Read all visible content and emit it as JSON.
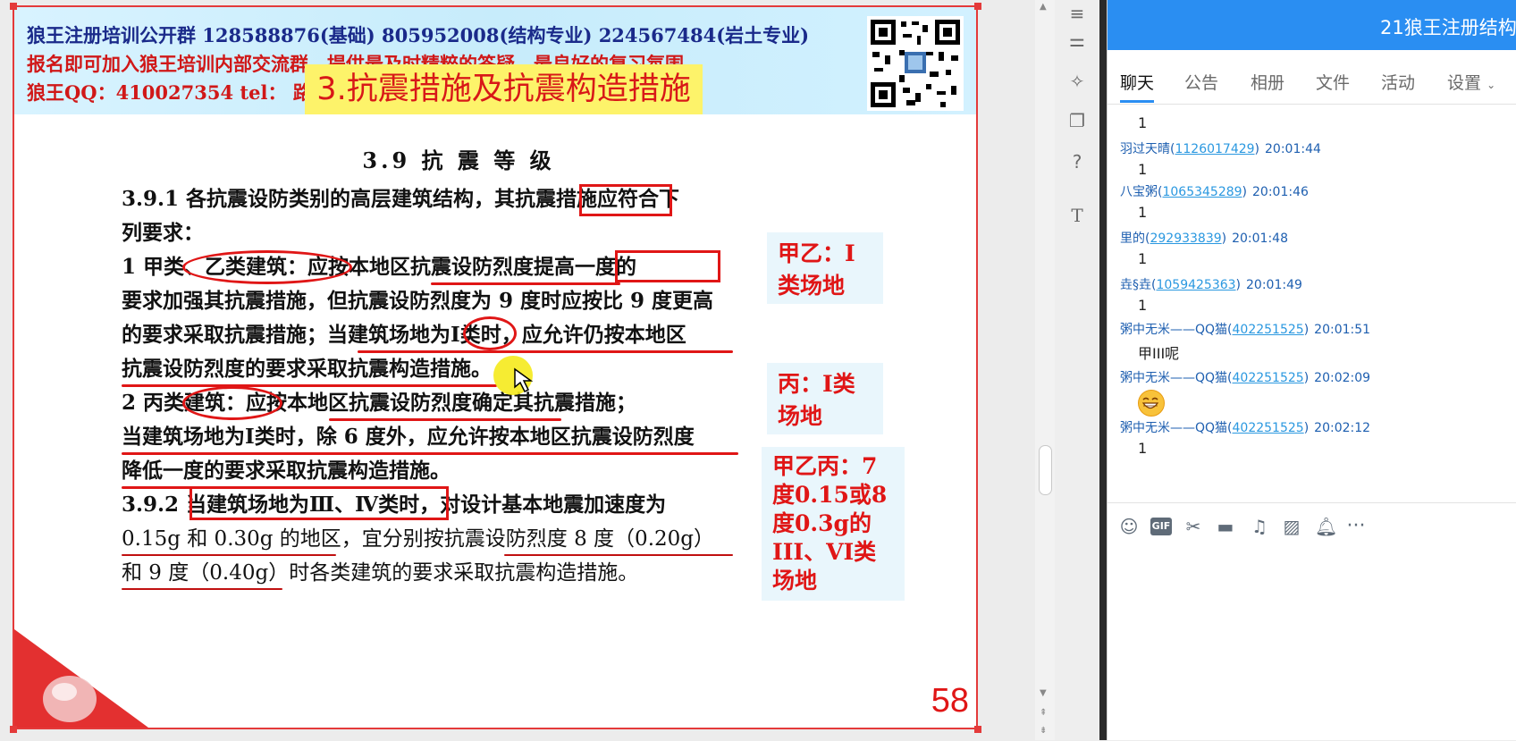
{
  "slide": {
    "banner": {
      "line1": "狼王注册培训公开群 128588876(基础)   805952008(结构专业) 224567484(岩土专业)",
      "line2": "报名即可加入狼王培训内部交流群，提供最及时精粹的答疑，最良好的复习氛围。",
      "line3": "狼王QQ：410027354     tel：                                  路专业)",
      "section_title": "3.抗震措施及抗震构造措施"
    },
    "doc": {
      "heading": "3.9  抗 震 等 级",
      "l1": "3.9.1  各抗震设防类别的高层建筑结构，其抗震措施应符合下",
      "l2": "列要求：",
      "l3": "    1  甲类、乙类建筑：应按本地区抗震设防烈度提高一度的",
      "l4": "要求加强其抗震措施，但抗震设防烈度为 9 度时应按比 9 度更高",
      "l5": "的要求采取抗震措施；当建筑场地为Ⅰ类时，应允许仍按本地区",
      "l6": "抗震设防烈度的要求采取抗震构造措施。",
      "l7": "    2  丙类建筑：应按本地区抗震设防烈度确定其抗震措施；",
      "l8": "当建筑场地为Ⅰ类时，除 6 度外，应允许按本地区抗震设防烈度",
      "l9": "降低一度的要求采取抗震构造措施。",
      "l10": "3.9.2  当建筑场地为Ⅲ、Ⅳ类时，对设计基本地震加速度为",
      "l11": "0.15g 和 0.30g 的地区，宜分别按抗震设防烈度 8 度（0.20g）",
      "l12": "和 9 度（0.40g）时各类建筑的要求采取抗震构造措施。"
    },
    "notes": {
      "n1a": "甲乙：I",
      "n1b": "类场地",
      "n2a": "丙：I类",
      "n2b": "场地",
      "n3a": "甲乙丙：7",
      "n3b": "度0.15或8",
      "n3c": "度0.3g的",
      "n3d": "III、VI类",
      "n3e": "场地"
    },
    "page_number": "58"
  },
  "chat": {
    "title": "21狼王注册结构",
    "tabs": [
      "聊天",
      "公告",
      "相册",
      "文件",
      "活动",
      "设置"
    ],
    "messages": [
      {
        "nick": "",
        "qq": "",
        "time": "",
        "body": "1"
      },
      {
        "nick": "羽过天晴(",
        "qq": "1126017429",
        "time": "20:01:44",
        "body": "1"
      },
      {
        "nick": "八宝粥(",
        "qq": "1065345289",
        "time": "20:01:46",
        "body": "1"
      },
      {
        "nick": "里的(",
        "qq": "292933839",
        "time": "20:01:48",
        "body": "1"
      },
      {
        "nick": "垚§垚(",
        "qq": "1059425363",
        "time": "20:01:49",
        "body": "1"
      },
      {
        "nick": "粥中无米——QQ猫(",
        "qq": "402251525",
        "time": "20:01:51",
        "body": "甲III呢"
      },
      {
        "nick": "粥中无米——QQ猫(",
        "qq": "402251525",
        "time": "20:02:09",
        "body": ""
      },
      {
        "nick": "粥中无米——QQ猫(",
        "qq": "402251525",
        "time": "20:02:12",
        "body": "1"
      }
    ],
    "toolbar_icons": [
      "emoji-icon",
      "gif-icon",
      "scissors-icon",
      "folder-icon",
      "music-icon",
      "image-icon",
      "bell-icon",
      "more-icon"
    ],
    "gif_label": "GIF"
  },
  "colors": {
    "accent": "#2a8ef2",
    "annotation_red": "#e01616",
    "note_bg": "#e9f6fc",
    "title_yellow": "#fdf36a"
  }
}
